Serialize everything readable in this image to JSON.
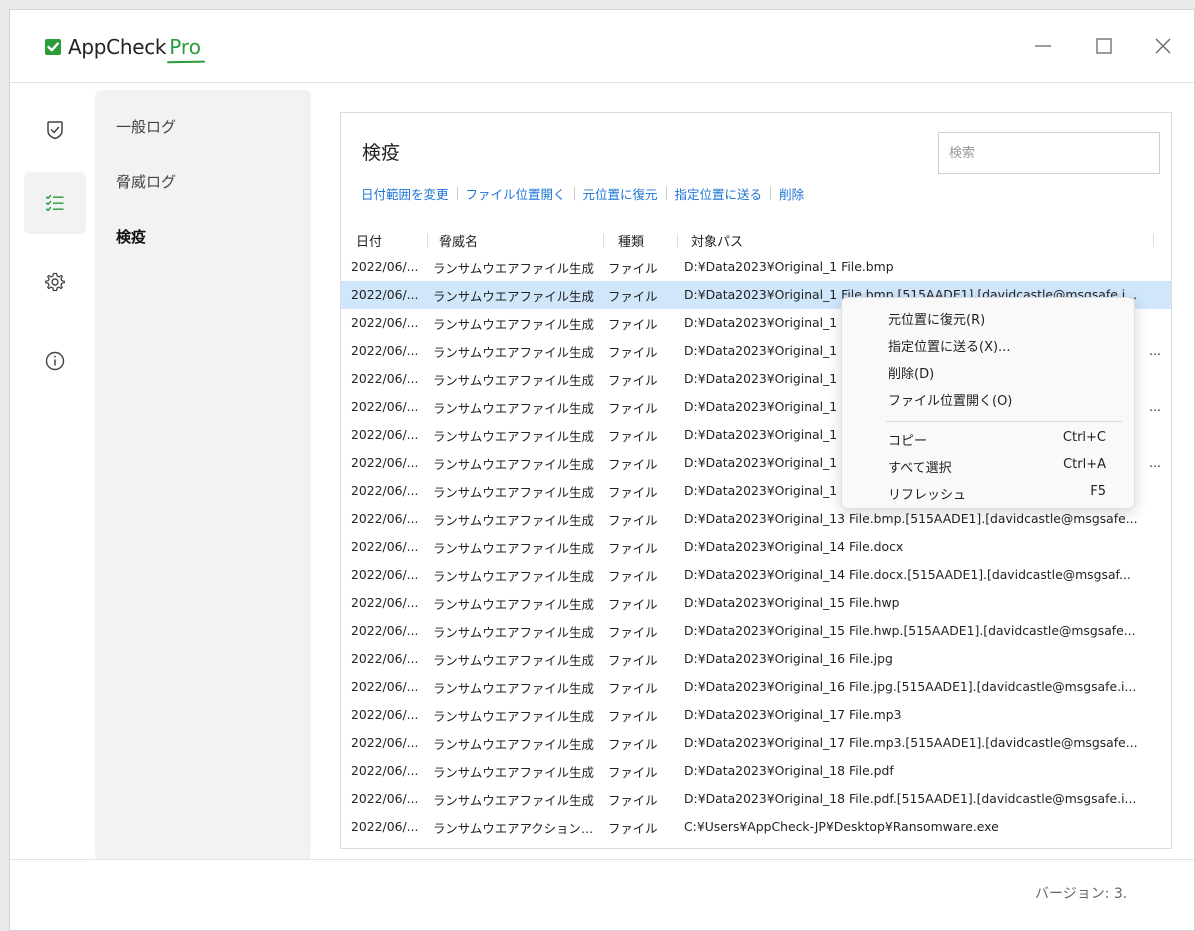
{
  "app": {
    "brand": "AppCheck",
    "brand_pro": "Pro"
  },
  "window_controls": [
    "minimize",
    "maximize",
    "close"
  ],
  "navrail": {
    "icons": [
      "shield-check-icon",
      "checklist-icon",
      "gear-icon",
      "info-icon"
    ],
    "active": "checklist-icon"
  },
  "subnav": {
    "items": [
      {
        "label": "一般ログ"
      },
      {
        "label": "脅威ログ"
      },
      {
        "label": "検疫"
      }
    ],
    "active": "検疫"
  },
  "panel": {
    "title": "検疫",
    "search_placeholder": "検索",
    "actions": [
      "日付範囲を変更",
      "ファイル位置開く",
      "元位置に復元",
      "指定位置に送る",
      "削除"
    ]
  },
  "table": {
    "columns": [
      "日付",
      "脅威名",
      "種類",
      "対象パス"
    ],
    "rows": [
      {
        "date": "2022/06/...",
        "threat": "ランサムウエアファイル生成",
        "type": "ファイル",
        "path": "D:¥Data2023¥Original_1 File.bmp"
      },
      {
        "date": "2022/06/...",
        "threat": "ランサムウエアファイル生成",
        "type": "ファイル",
        "path": "D:¥Data2023¥Original_1 File.bmp.[515AADE1].[davidcastle@msgsafe.i...",
        "selected": true
      },
      {
        "date": "2022/06/...",
        "threat": "ランサムウエアファイル生成",
        "type": "ファイル",
        "path": "D:¥Data2023¥Original_1"
      },
      {
        "date": "2022/06/...",
        "threat": "ランサムウエアファイル生成",
        "type": "ファイル",
        "path": "D:¥Data2023¥Original_1",
        "tail": "..."
      },
      {
        "date": "2022/06/...",
        "threat": "ランサムウエアファイル生成",
        "type": "ファイル",
        "path": "D:¥Data2023¥Original_1"
      },
      {
        "date": "2022/06/...",
        "threat": "ランサムウエアファイル生成",
        "type": "ファイル",
        "path": "D:¥Data2023¥Original_1",
        "tail": "..."
      },
      {
        "date": "2022/06/...",
        "threat": "ランサムウエアファイル生成",
        "type": "ファイル",
        "path": "D:¥Data2023¥Original_1"
      },
      {
        "date": "2022/06/...",
        "threat": "ランサムウエアファイル生成",
        "type": "ファイル",
        "path": "D:¥Data2023¥Original_1",
        "tail": "..."
      },
      {
        "date": "2022/06/...",
        "threat": "ランサムウエアファイル生成",
        "type": "ファイル",
        "path": "D:¥Data2023¥Original_1"
      },
      {
        "date": "2022/06/...",
        "threat": "ランサムウエアファイル生成",
        "type": "ファイル",
        "path": "D:¥Data2023¥Original_13 File.bmp.[515AADE1].[davidcastle@msgsafe..."
      },
      {
        "date": "2022/06/...",
        "threat": "ランサムウエアファイル生成",
        "type": "ファイル",
        "path": "D:¥Data2023¥Original_14 File.docx"
      },
      {
        "date": "2022/06/...",
        "threat": "ランサムウエアファイル生成",
        "type": "ファイル",
        "path": "D:¥Data2023¥Original_14 File.docx.[515AADE1].[davidcastle@msgsaf..."
      },
      {
        "date": "2022/06/...",
        "threat": "ランサムウエアファイル生成",
        "type": "ファイル",
        "path": "D:¥Data2023¥Original_15 File.hwp"
      },
      {
        "date": "2022/06/...",
        "threat": "ランサムウエアファイル生成",
        "type": "ファイル",
        "path": "D:¥Data2023¥Original_15 File.hwp.[515AADE1].[davidcastle@msgsafe..."
      },
      {
        "date": "2022/06/...",
        "threat": "ランサムウエアファイル生成",
        "type": "ファイル",
        "path": "D:¥Data2023¥Original_16 File.jpg"
      },
      {
        "date": "2022/06/...",
        "threat": "ランサムウエアファイル生成",
        "type": "ファイル",
        "path": "D:¥Data2023¥Original_16 File.jpg.[515AADE1].[davidcastle@msgsafe.i..."
      },
      {
        "date": "2022/06/...",
        "threat": "ランサムウエアファイル生成",
        "type": "ファイル",
        "path": "D:¥Data2023¥Original_17 File.mp3"
      },
      {
        "date": "2022/06/...",
        "threat": "ランサムウエアファイル生成",
        "type": "ファイル",
        "path": "D:¥Data2023¥Original_17 File.mp3.[515AADE1].[davidcastle@msgsafe..."
      },
      {
        "date": "2022/06/...",
        "threat": "ランサムウエアファイル生成",
        "type": "ファイル",
        "path": "D:¥Data2023¥Original_18 File.pdf"
      },
      {
        "date": "2022/06/...",
        "threat": "ランサムウエアファイル生成",
        "type": "ファイル",
        "path": "D:¥Data2023¥Original_18 File.pdf.[515AADE1].[davidcastle@msgsafe.i..."
      },
      {
        "date": "2022/06/...",
        "threat": "ランサムウエアアクション検知",
        "type": "ファイル",
        "path": "C:¥Users¥AppCheck-JP¥Desktop¥Ransomware.exe"
      }
    ]
  },
  "context_menu": {
    "items": [
      {
        "label": "元位置に復元(R)",
        "shortcut": ""
      },
      {
        "label": "指定位置に送る(X)...",
        "shortcut": ""
      },
      {
        "label": "削除(D)",
        "shortcut": ""
      },
      {
        "label": "ファイル位置開く(O)",
        "shortcut": ""
      },
      {
        "label": "コピー",
        "shortcut": "Ctrl+C"
      },
      {
        "label": "すべて選択",
        "shortcut": "Ctrl+A"
      },
      {
        "label": "リフレッシュ",
        "shortcut": "F5"
      }
    ]
  },
  "footer": {
    "version": "バージョン: 3."
  },
  "colors": {
    "accent_green": "#2c9b3a",
    "link_blue": "#1b73d6",
    "selection": "#cfe6fb"
  }
}
